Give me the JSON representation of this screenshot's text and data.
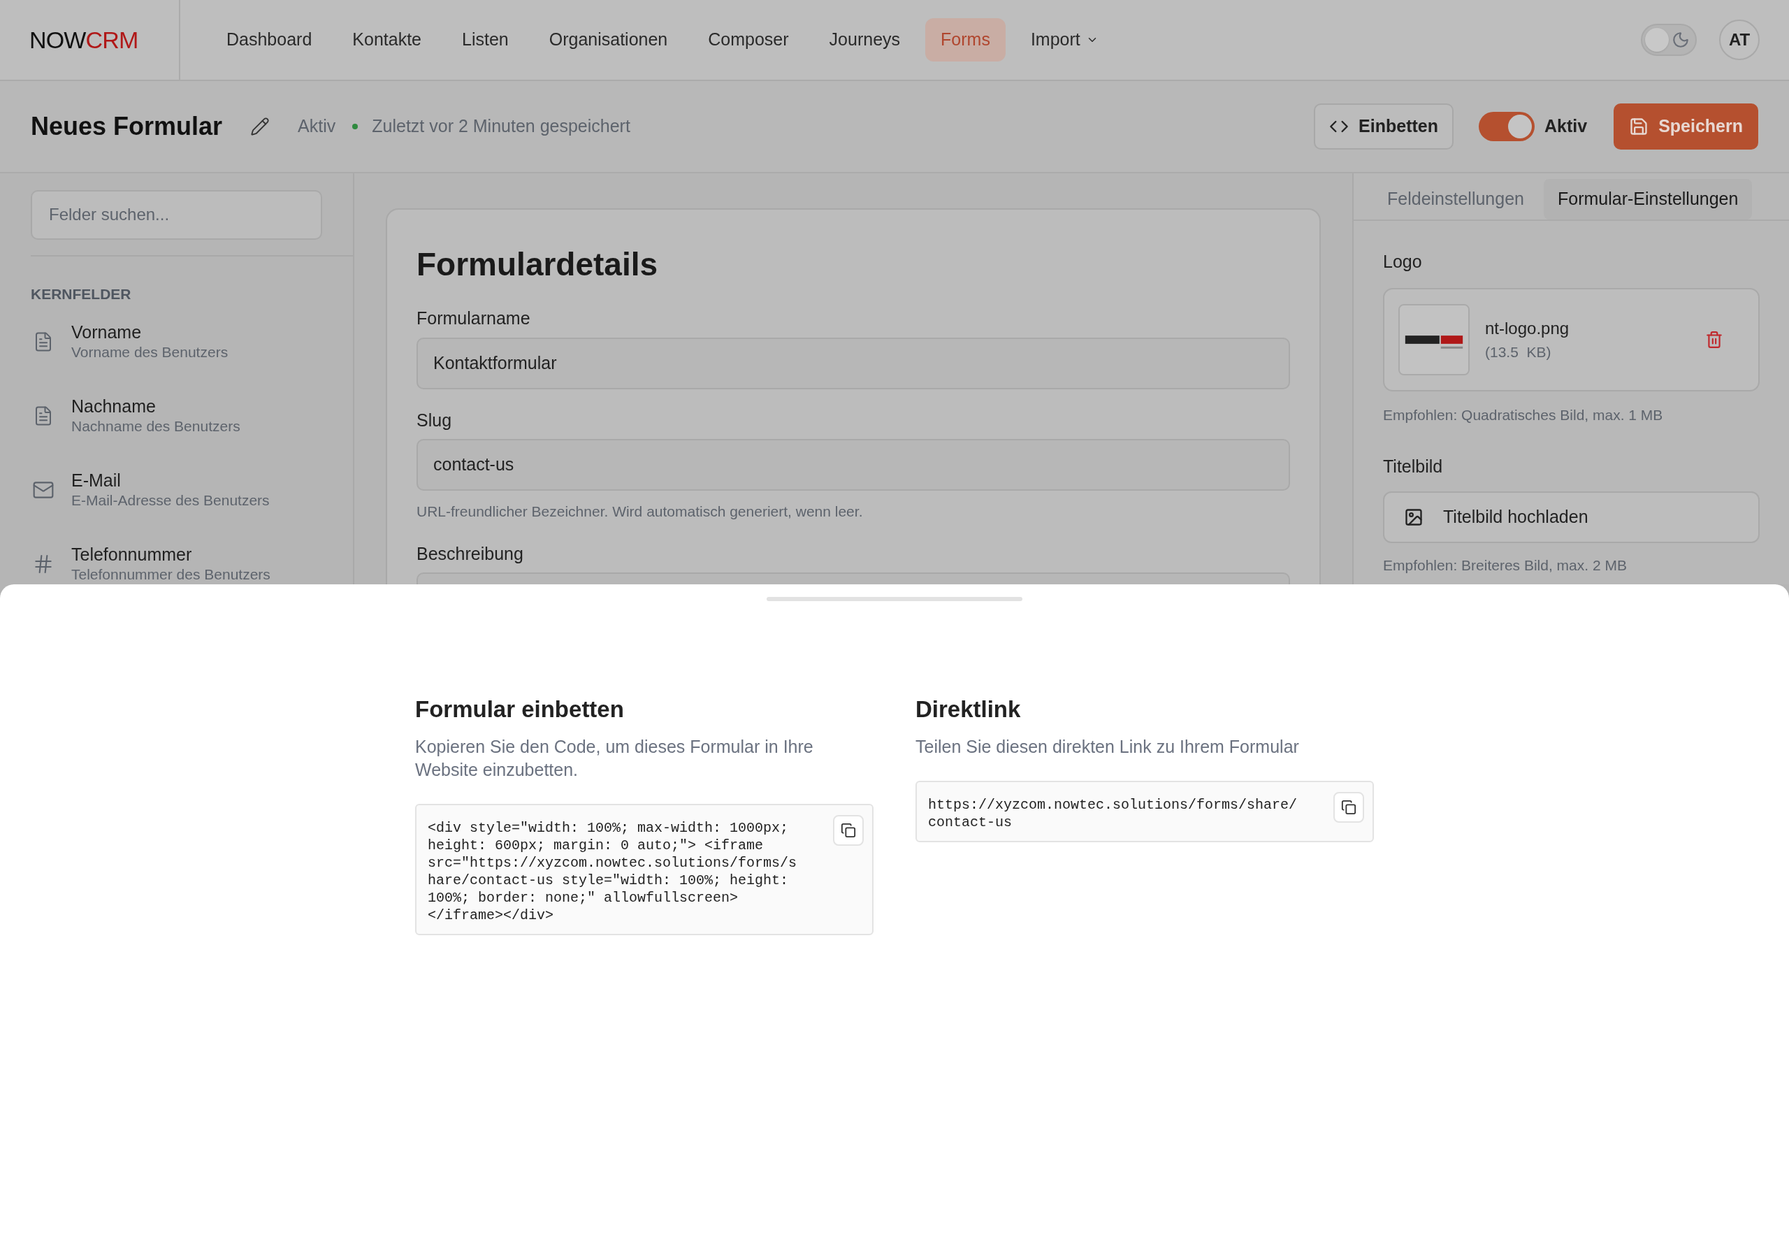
{
  "nav": {
    "logo": {
      "first": "NOW",
      "second": "CRM"
    },
    "items": [
      {
        "label": "Dashboard",
        "selected": false,
        "kind": "link"
      },
      {
        "label": "Kontakte",
        "selected": false,
        "kind": "link"
      },
      {
        "label": "Listen",
        "selected": false,
        "kind": "link"
      },
      {
        "label": "Organisationen",
        "selected": false,
        "kind": "link"
      },
      {
        "label": "Composer",
        "selected": false,
        "kind": "link"
      },
      {
        "label": "Journeys",
        "selected": false,
        "kind": "link"
      },
      {
        "label": "Forms",
        "selected": true,
        "kind": "link"
      },
      {
        "label": "Import",
        "selected": false,
        "kind": "dropdown"
      }
    ],
    "dark_mode": {
      "on": false
    },
    "avatar": "AT"
  },
  "header": {
    "title": "Neues Formular",
    "status": "Aktiv",
    "saved": "Zuletzt vor 2 Minuten gespeichert",
    "embed_button": "Einbetten",
    "active_toggle": {
      "label": "Aktiv",
      "on": true
    },
    "save_button": "Speichern"
  },
  "sidebar": {
    "search": {
      "placeholder": "Felder suchen..."
    },
    "section": "KERNFELDER",
    "fields": [
      {
        "kind": "text",
        "name": "Vorname",
        "description": "Vorname des Benutzers"
      },
      {
        "kind": "text",
        "name": "Nachname",
        "description": "Nachname des Benutzers"
      },
      {
        "kind": "email",
        "name": "E-Mail",
        "description": "E-Mail-Adresse des Benutzers"
      },
      {
        "kind": "number",
        "name": "Telefonnummer",
        "description": "Telefonnummer des Benutzers"
      }
    ]
  },
  "form_details": {
    "title": "Formulardetails",
    "fields": [
      {
        "label": "Formularname",
        "value": "Kontaktformular"
      },
      {
        "label": "Slug",
        "value": "contact-us",
        "hint": "URL-freundlicher Bezeichner. Wird automatisch generiert, wenn leer."
      },
      {
        "label": "Beschreibung"
      }
    ]
  },
  "settings_panel": {
    "tabs": [
      {
        "label": "Feldeinstellungen",
        "selected": false
      },
      {
        "label": "Formular-Einstellungen",
        "selected": true
      }
    ],
    "logo_label": "Logo",
    "logo_file": {
      "kind": "picture",
      "name": "nt-logo.png",
      "size": "(13.5  KB)"
    },
    "logo_hint": "Empfohlen: Quadratisches Bild, max. 1 MB",
    "cover_label": "Titelbild",
    "cover_button": "Titelbild hochladen",
    "cover_hint": "Empfohlen: Breiteres Bild, max. 2 MB"
  },
  "embed_drawer": {
    "sections": [
      {
        "title": "Formular einbetten",
        "description": "Kopieren Sie den Code, um dieses Formular in Ihre Website einzubetten.",
        "code": "<div style=\"width: 100%; max-width: 1000px; height: 600px; margin: 0 auto;\"> <iframe src=\"https://xyzcom.nowtec.solutions/forms/share/contact-us style=\"width: 100%; height: 100%; border: none;\" allowfullscreen></iframe></div>"
      },
      {
        "title": "Direktlink",
        "description": "Teilen Sie diesen direkten Link zu Ihrem Formular",
        "code": "https://xyzcom.nowtec.solutions/forms/share/contact-us"
      }
    ]
  }
}
